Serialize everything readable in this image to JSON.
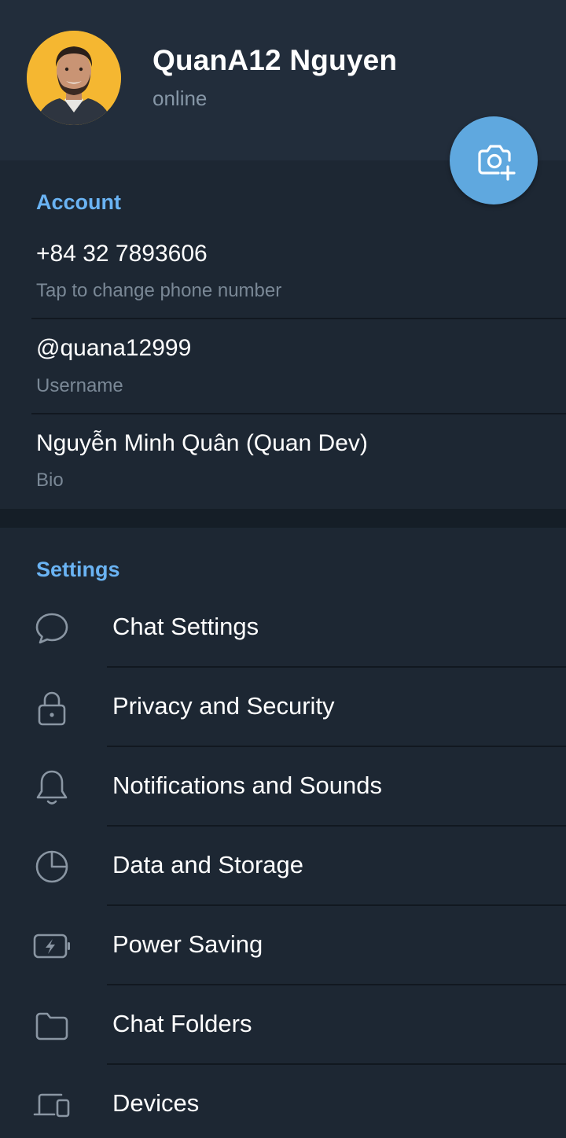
{
  "profile": {
    "name": "QuanA12 Nguyen",
    "status": "online"
  },
  "account": {
    "title": "Account",
    "phone": {
      "value": "+84 32 7893606",
      "label": "Tap to change phone number"
    },
    "username": {
      "value": "@quana12999",
      "label": "Username"
    },
    "bio": {
      "value": "Nguyễn Minh Quân (Quan Dev)",
      "label": "Bio"
    }
  },
  "settings": {
    "title": "Settings",
    "items": [
      {
        "label": "Chat Settings",
        "icon": "chat-bubble-icon"
      },
      {
        "label": "Privacy and Security",
        "icon": "lock-icon"
      },
      {
        "label": "Notifications and Sounds",
        "icon": "bell-icon"
      },
      {
        "label": "Data and Storage",
        "icon": "pie-chart-icon"
      },
      {
        "label": "Power Saving",
        "icon": "battery-bolt-icon"
      },
      {
        "label": "Chat Folders",
        "icon": "folder-icon"
      },
      {
        "label": "Devices",
        "icon": "devices-icon"
      }
    ]
  },
  "colors": {
    "accent": "#6ab3f3",
    "fab": "#5fa8df",
    "background": "#1d2733",
    "header": "#222d3b",
    "avatar_bg": "#f5b731"
  },
  "icons": {
    "fab": "camera-add-icon"
  }
}
